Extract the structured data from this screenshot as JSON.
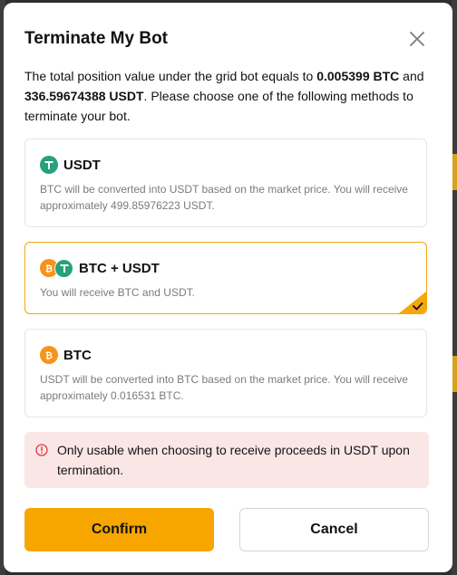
{
  "dialog": {
    "title": "Terminate My Bot",
    "description": {
      "part1": "The total position value under the grid bot equals to ",
      "btc_amount": "0.005399 BTC",
      "part2": " and ",
      "usdt_amount": "336.59674388 USDT",
      "part3": ". Please choose one of the following methods to terminate your bot."
    },
    "options": [
      {
        "name": "USDT",
        "description": "BTC will be converted into USDT based on the market price. You will receive approximately 499.85976223 USDT.",
        "icon": "usdt-coin-icon",
        "selected": false
      },
      {
        "name": "BTC + USDT",
        "description": "You will receive BTC and USDT.",
        "icon": "btc-usdt-coin-icons",
        "selected": true
      },
      {
        "name": "BTC",
        "description": "USDT will be converted into BTC based on the market price. You will receive approximately 0.016531 BTC.",
        "icon": "btc-coin-icon",
        "selected": false
      }
    ],
    "notice": "Only usable when choosing to receive proceeds in USDT upon termination.",
    "confirm_label": "Confirm",
    "cancel_label": "Cancel"
  },
  "colors": {
    "accent": "#f7a600",
    "selected_border": "#f5a60a",
    "usdt": "#26a17b",
    "btc": "#f7931a",
    "notice_bg": "#fbe6e6",
    "notice_icon": "#e03a3a"
  }
}
